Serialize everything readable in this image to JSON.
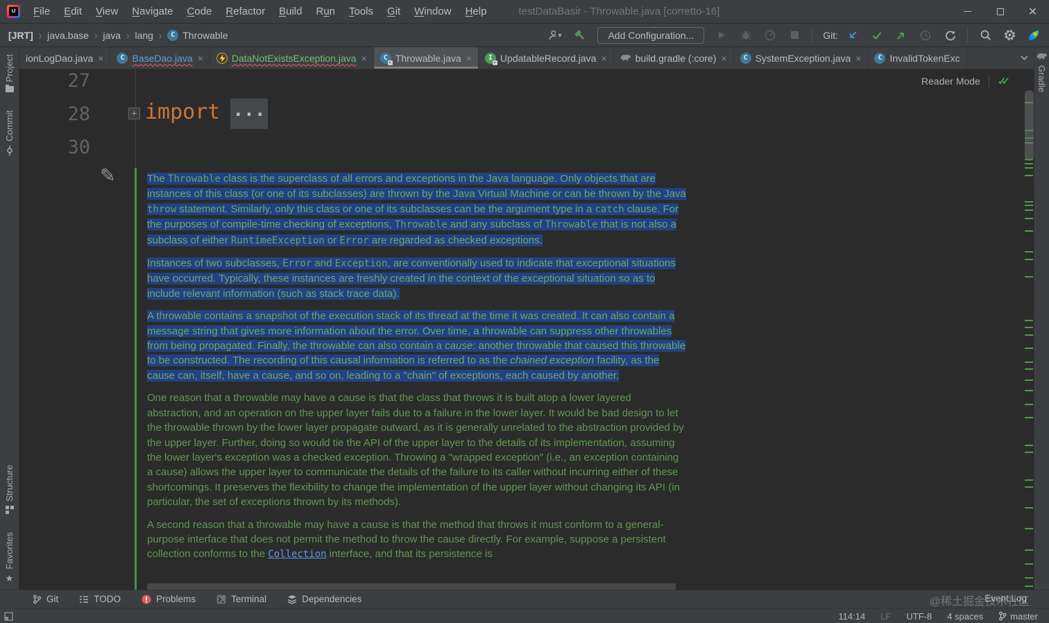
{
  "window": {
    "title": "testDataBasir - Throwable.java [corretto-16]",
    "controls": {
      "minimize": "minimize",
      "restore": "restore",
      "close": "close"
    }
  },
  "menubar": {
    "items": [
      {
        "label": "File",
        "u": 0
      },
      {
        "label": "Edit",
        "u": 0
      },
      {
        "label": "View",
        "u": 0
      },
      {
        "label": "Navigate",
        "u": 0
      },
      {
        "label": "Code",
        "u": 0
      },
      {
        "label": "Refactor",
        "u": 0
      },
      {
        "label": "Build",
        "u": 0
      },
      {
        "label": "Run",
        "u": 1
      },
      {
        "label": "Tools",
        "u": 0
      },
      {
        "label": "Git",
        "u": 0
      },
      {
        "label": "Window",
        "u": 0
      },
      {
        "label": "Help",
        "u": 0
      }
    ]
  },
  "breadcrumbs": {
    "items": [
      "[JRT]",
      "java.base",
      "java",
      "lang"
    ],
    "class_name": "Throwable"
  },
  "toolbar": {
    "add_configuration": "Add Configuration...",
    "git_label": "Git:"
  },
  "editor_tabs": [
    {
      "label": "ionLogDao.java",
      "icon": null,
      "color": "plain",
      "closable": true
    },
    {
      "label": "BaseDao.java",
      "icon": "class",
      "color": "modified-blue",
      "error_underline": true,
      "closable": true
    },
    {
      "label": "DataNotExistsException.java",
      "icon": "exception",
      "color": "added-green",
      "error_underline": true,
      "closable": true
    },
    {
      "label": "Throwable.java",
      "icon": "class-lock",
      "color": "plain",
      "active": true,
      "closable": true
    },
    {
      "label": "UpdatableRecord.java",
      "icon": "interface-lock",
      "color": "plain",
      "closable": true
    },
    {
      "label": "build.gradle (:core)",
      "icon": "gradle",
      "color": "plain",
      "closable": true
    },
    {
      "label": "SystemException.java",
      "icon": "class",
      "color": "plain",
      "closable": true
    },
    {
      "label": "InvalidTokenExc",
      "icon": "class",
      "color": "plain",
      "closable": false
    }
  ],
  "left_toolbar": {
    "items": [
      "Project",
      "Commit",
      "Structure",
      "Favorites"
    ]
  },
  "right_toolbar": {
    "items": [
      "Gradle"
    ]
  },
  "editor": {
    "reader_mode_label": "Reader Mode",
    "line_numbers": [
      "27",
      "28",
      "30"
    ],
    "folded_import": {
      "keyword": "import",
      "ellipsis": "...",
      "fold_plus": "+"
    },
    "scroll_marks": [
      47,
      87,
      98,
      105,
      129,
      135,
      141,
      152,
      190,
      195,
      202,
      214,
      232,
      262,
      273,
      298,
      361,
      371,
      382,
      401,
      421,
      431,
      447,
      462,
      482,
      501,
      541,
      551,
      591,
      601,
      631,
      661,
      692,
      712,
      732,
      744
    ],
    "doc_paragraphs": [
      {
        "selected": true,
        "segments": [
          {
            "text": "The "
          },
          {
            "text": "Throwable",
            "style": "code"
          },
          {
            "text": " class is the superclass of all errors and exceptions in the Java language. Only objects that are instances of this class (or one of its subclasses) are thrown by the Java Virtual Machine or can be thrown by the Java "
          },
          {
            "text": "throw",
            "style": "code"
          },
          {
            "text": " statement. Similarly, only this class or one of its subclasses can be the argument type in a "
          },
          {
            "text": "catch",
            "style": "code"
          },
          {
            "text": " clause. For the purposes of compile-time checking of exceptions, "
          },
          {
            "text": "Throwable",
            "style": "code"
          },
          {
            "text": " and any subclass of "
          },
          {
            "text": "Throwable",
            "style": "code"
          },
          {
            "text": " that is not also a subclass of either "
          },
          {
            "text": "RuntimeException",
            "style": "code"
          },
          {
            "text": " or "
          },
          {
            "text": "Error",
            "style": "code"
          },
          {
            "text": " are regarded as checked exceptions."
          }
        ]
      },
      {
        "selected": true,
        "segments": [
          {
            "text": "Instances of two subclasses, "
          },
          {
            "text": "Error",
            "style": "code"
          },
          {
            "text": " and "
          },
          {
            "text": "Exception",
            "style": "code"
          },
          {
            "text": ", are conventionally used to indicate that exceptional situations have occurred. Typically, these instances are freshly created in the context of the exceptional situation so as to include relevant information (such as stack trace data)."
          }
        ]
      },
      {
        "selected": true,
        "segments": [
          {
            "text": "A throwable contains a snapshot of the execution stack of its thread at the time it was created. It can also contain a message string that gives more information about the error. Over time, a throwable can suppress other throwables from being propagated. Finally, the throwable can also contain a "
          },
          {
            "text": "cause",
            "style": "italic"
          },
          {
            "text": ": another throwable that caused this throwable to be constructed. The recording of this causal information is referred to as the "
          },
          {
            "text": "chained exception",
            "style": "italic"
          },
          {
            "text": " facility, as the cause can, itself, have a cause, and so on, leading to a \"chain\" of exceptions, each caused by another."
          }
        ]
      },
      {
        "selected": false,
        "segments": [
          {
            "text": "One reason that a throwable may have a cause is that the class that throws it is built atop a lower layered abstraction, and an operation on the upper layer fails due to a failure in the lower layer. It would be bad design to let the throwable thrown by the lower layer propagate outward, as it is generally unrelated to the abstraction provided by the upper layer. Further, doing so would tie the API of the upper layer to the details of its implementation, assuming the lower layer's exception was a checked exception. Throwing a \"wrapped exception\" (i.e., an exception containing a cause) allows the upper layer to communicate the details of the failure to its caller without incurring either of these shortcomings. It preserves the flexibility to change the implementation of the upper layer without changing its API (in particular, the set of exceptions thrown by its methods)."
          }
        ]
      },
      {
        "selected": false,
        "segments": [
          {
            "text": "A second reason that a throwable may have a cause is that the method that throws it must conform to a general-purpose interface that does not permit the method to throw the cause directly. For example, suppose a persistent collection conforms to the "
          },
          {
            "text": "Collection",
            "style": "link"
          },
          {
            "text": " interface, and that its persistence is"
          }
        ]
      }
    ]
  },
  "bottom_bar": {
    "items": [
      {
        "label": "Git",
        "icon": "git-branch"
      },
      {
        "label": "TODO",
        "icon": "todo-list"
      },
      {
        "label": "Problems",
        "icon": "error"
      },
      {
        "label": "Terminal",
        "icon": "terminal"
      },
      {
        "label": "Dependencies",
        "icon": "layers"
      }
    ],
    "event_log": "Event Log",
    "watermark": "@稀土掘金技术社区"
  },
  "status_bar": {
    "position": "114:14",
    "line_separator": "LF",
    "encoding": "UTF-8",
    "indent": "4 spaces",
    "branch": "master"
  },
  "colors": {
    "selection_blue": "#214283",
    "doc_comment_green": "#629755",
    "keyword_orange": "#CC7832",
    "tab_modified_blue": "#609DD2",
    "tab_added_green": "#73BD79",
    "error_red": "#ff5261",
    "vcs_added_green": "#4F9C45",
    "link_blue": "#589DF6",
    "toolbar_bg": "#3c3f41",
    "editor_bg": "#2b2b2b"
  }
}
